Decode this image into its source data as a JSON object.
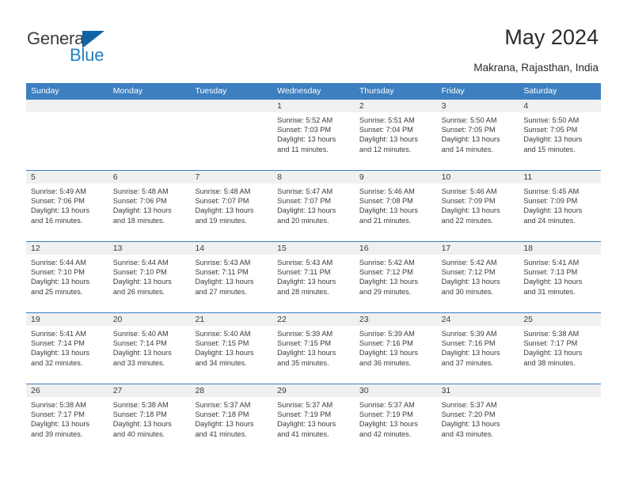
{
  "brand": {
    "word_general": "General",
    "word_blue": "Blue",
    "accent_color": "#1163a5",
    "blue_text_color": "#1f7fc4"
  },
  "header": {
    "title": "May 2024",
    "subtitle": "Makrana, Rajasthan, India"
  },
  "calendar": {
    "header_color": "#3d7fbf",
    "daynum_band_color": "#f0f0f0",
    "weekdays": [
      "Sunday",
      "Monday",
      "Tuesday",
      "Wednesday",
      "Thursday",
      "Friday",
      "Saturday"
    ],
    "weeks": [
      [
        {
          "day": "",
          "sunrise": "",
          "sunset": "",
          "daylight_line1": "",
          "daylight_line2": ""
        },
        {
          "day": "",
          "sunrise": "",
          "sunset": "",
          "daylight_line1": "",
          "daylight_line2": ""
        },
        {
          "day": "",
          "sunrise": "",
          "sunset": "",
          "daylight_line1": "",
          "daylight_line2": ""
        },
        {
          "day": "1",
          "sunrise": "Sunrise: 5:52 AM",
          "sunset": "Sunset: 7:03 PM",
          "daylight_line1": "Daylight: 13 hours",
          "daylight_line2": "and 11 minutes."
        },
        {
          "day": "2",
          "sunrise": "Sunrise: 5:51 AM",
          "sunset": "Sunset: 7:04 PM",
          "daylight_line1": "Daylight: 13 hours",
          "daylight_line2": "and 12 minutes."
        },
        {
          "day": "3",
          "sunrise": "Sunrise: 5:50 AM",
          "sunset": "Sunset: 7:05 PM",
          "daylight_line1": "Daylight: 13 hours",
          "daylight_line2": "and 14 minutes."
        },
        {
          "day": "4",
          "sunrise": "Sunrise: 5:50 AM",
          "sunset": "Sunset: 7:05 PM",
          "daylight_line1": "Daylight: 13 hours",
          "daylight_line2": "and 15 minutes."
        }
      ],
      [
        {
          "day": "5",
          "sunrise": "Sunrise: 5:49 AM",
          "sunset": "Sunset: 7:06 PM",
          "daylight_line1": "Daylight: 13 hours",
          "daylight_line2": "and 16 minutes."
        },
        {
          "day": "6",
          "sunrise": "Sunrise: 5:48 AM",
          "sunset": "Sunset: 7:06 PM",
          "daylight_line1": "Daylight: 13 hours",
          "daylight_line2": "and 18 minutes."
        },
        {
          "day": "7",
          "sunrise": "Sunrise: 5:48 AM",
          "sunset": "Sunset: 7:07 PM",
          "daylight_line1": "Daylight: 13 hours",
          "daylight_line2": "and 19 minutes."
        },
        {
          "day": "8",
          "sunrise": "Sunrise: 5:47 AM",
          "sunset": "Sunset: 7:07 PM",
          "daylight_line1": "Daylight: 13 hours",
          "daylight_line2": "and 20 minutes."
        },
        {
          "day": "9",
          "sunrise": "Sunrise: 5:46 AM",
          "sunset": "Sunset: 7:08 PM",
          "daylight_line1": "Daylight: 13 hours",
          "daylight_line2": "and 21 minutes."
        },
        {
          "day": "10",
          "sunrise": "Sunrise: 5:46 AM",
          "sunset": "Sunset: 7:09 PM",
          "daylight_line1": "Daylight: 13 hours",
          "daylight_line2": "and 22 minutes."
        },
        {
          "day": "11",
          "sunrise": "Sunrise: 5:45 AM",
          "sunset": "Sunset: 7:09 PM",
          "daylight_line1": "Daylight: 13 hours",
          "daylight_line2": "and 24 minutes."
        }
      ],
      [
        {
          "day": "12",
          "sunrise": "Sunrise: 5:44 AM",
          "sunset": "Sunset: 7:10 PM",
          "daylight_line1": "Daylight: 13 hours",
          "daylight_line2": "and 25 minutes."
        },
        {
          "day": "13",
          "sunrise": "Sunrise: 5:44 AM",
          "sunset": "Sunset: 7:10 PM",
          "daylight_line1": "Daylight: 13 hours",
          "daylight_line2": "and 26 minutes."
        },
        {
          "day": "14",
          "sunrise": "Sunrise: 5:43 AM",
          "sunset": "Sunset: 7:11 PM",
          "daylight_line1": "Daylight: 13 hours",
          "daylight_line2": "and 27 minutes."
        },
        {
          "day": "15",
          "sunrise": "Sunrise: 5:43 AM",
          "sunset": "Sunset: 7:11 PM",
          "daylight_line1": "Daylight: 13 hours",
          "daylight_line2": "and 28 minutes."
        },
        {
          "day": "16",
          "sunrise": "Sunrise: 5:42 AM",
          "sunset": "Sunset: 7:12 PM",
          "daylight_line1": "Daylight: 13 hours",
          "daylight_line2": "and 29 minutes."
        },
        {
          "day": "17",
          "sunrise": "Sunrise: 5:42 AM",
          "sunset": "Sunset: 7:12 PM",
          "daylight_line1": "Daylight: 13 hours",
          "daylight_line2": "and 30 minutes."
        },
        {
          "day": "18",
          "sunrise": "Sunrise: 5:41 AM",
          "sunset": "Sunset: 7:13 PM",
          "daylight_line1": "Daylight: 13 hours",
          "daylight_line2": "and 31 minutes."
        }
      ],
      [
        {
          "day": "19",
          "sunrise": "Sunrise: 5:41 AM",
          "sunset": "Sunset: 7:14 PM",
          "daylight_line1": "Daylight: 13 hours",
          "daylight_line2": "and 32 minutes."
        },
        {
          "day": "20",
          "sunrise": "Sunrise: 5:40 AM",
          "sunset": "Sunset: 7:14 PM",
          "daylight_line1": "Daylight: 13 hours",
          "daylight_line2": "and 33 minutes."
        },
        {
          "day": "21",
          "sunrise": "Sunrise: 5:40 AM",
          "sunset": "Sunset: 7:15 PM",
          "daylight_line1": "Daylight: 13 hours",
          "daylight_line2": "and 34 minutes."
        },
        {
          "day": "22",
          "sunrise": "Sunrise: 5:39 AM",
          "sunset": "Sunset: 7:15 PM",
          "daylight_line1": "Daylight: 13 hours",
          "daylight_line2": "and 35 minutes."
        },
        {
          "day": "23",
          "sunrise": "Sunrise: 5:39 AM",
          "sunset": "Sunset: 7:16 PM",
          "daylight_line1": "Daylight: 13 hours",
          "daylight_line2": "and 36 minutes."
        },
        {
          "day": "24",
          "sunrise": "Sunrise: 5:39 AM",
          "sunset": "Sunset: 7:16 PM",
          "daylight_line1": "Daylight: 13 hours",
          "daylight_line2": "and 37 minutes."
        },
        {
          "day": "25",
          "sunrise": "Sunrise: 5:38 AM",
          "sunset": "Sunset: 7:17 PM",
          "daylight_line1": "Daylight: 13 hours",
          "daylight_line2": "and 38 minutes."
        }
      ],
      [
        {
          "day": "26",
          "sunrise": "Sunrise: 5:38 AM",
          "sunset": "Sunset: 7:17 PM",
          "daylight_line1": "Daylight: 13 hours",
          "daylight_line2": "and 39 minutes."
        },
        {
          "day": "27",
          "sunrise": "Sunrise: 5:38 AM",
          "sunset": "Sunset: 7:18 PM",
          "daylight_line1": "Daylight: 13 hours",
          "daylight_line2": "and 40 minutes."
        },
        {
          "day": "28",
          "sunrise": "Sunrise: 5:37 AM",
          "sunset": "Sunset: 7:18 PM",
          "daylight_line1": "Daylight: 13 hours",
          "daylight_line2": "and 41 minutes."
        },
        {
          "day": "29",
          "sunrise": "Sunrise: 5:37 AM",
          "sunset": "Sunset: 7:19 PM",
          "daylight_line1": "Daylight: 13 hours",
          "daylight_line2": "and 41 minutes."
        },
        {
          "day": "30",
          "sunrise": "Sunrise: 5:37 AM",
          "sunset": "Sunset: 7:19 PM",
          "daylight_line1": "Daylight: 13 hours",
          "daylight_line2": "and 42 minutes."
        },
        {
          "day": "31",
          "sunrise": "Sunrise: 5:37 AM",
          "sunset": "Sunset: 7:20 PM",
          "daylight_line1": "Daylight: 13 hours",
          "daylight_line2": "and 43 minutes."
        },
        {
          "day": "",
          "sunrise": "",
          "sunset": "",
          "daylight_line1": "",
          "daylight_line2": ""
        }
      ]
    ]
  }
}
